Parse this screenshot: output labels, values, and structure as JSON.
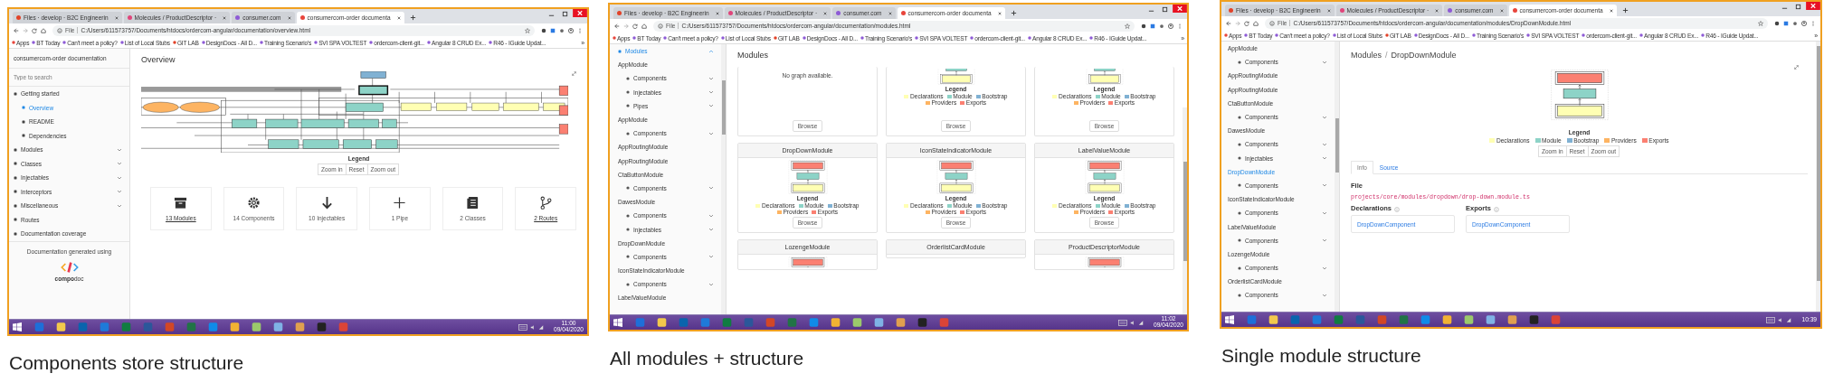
{
  "screens": [
    {
      "kind": "overview",
      "browser": {
        "tabs": [
          {
            "title": "Files · develop · B2C Engineerin",
            "selected": false
          },
          {
            "title": "Molecules / ProductDescriptor ·",
            "selected": false
          },
          {
            "title": "consumer.com",
            "selected": false
          },
          {
            "title": "consumercom-order documenta",
            "selected": true
          }
        ],
        "scheme": "File",
        "url": "C:/Users/611573757/Documents/htdocs/ordercom-angular/documentation/overview.html",
        "bookmarks": [
          "Apps",
          "BT Today",
          "Can't meet a policy?",
          "List of Local Stubs",
          "GIT LAB",
          "DesignDocs - All D...",
          "Training Scenario's",
          "SVI SPA VOLTEST",
          "ordercom-client-git...",
          "Angular 8 CRUD Ex...",
          "R46 - IGuide Updat..."
        ],
        "bookmarks_more": "»"
      },
      "sidebar": {
        "title": "consumercom-order documentation",
        "search": {
          "placeholder": "Type to search"
        },
        "items": [
          {
            "label": "Getting started",
            "kind": "group",
            "selected": false
          },
          {
            "label": "Overview",
            "kind": "link",
            "selected": true
          },
          {
            "label": "README",
            "kind": "link",
            "selected": false
          },
          {
            "label": "Dependencies",
            "kind": "link",
            "selected": false
          },
          {
            "label": "Modules",
            "kind": "section",
            "expanded": false,
            "selected": false
          },
          {
            "label": "Classes",
            "kind": "section",
            "expanded": false,
            "selected": false
          },
          {
            "label": "Injectables",
            "kind": "section",
            "expanded": false,
            "selected": false
          },
          {
            "label": "Interceptors",
            "kind": "section",
            "expanded": false,
            "selected": false
          },
          {
            "label": "Miscellaneous",
            "kind": "section",
            "expanded": false,
            "selected": false
          },
          {
            "label": "Routes",
            "kind": "group",
            "selected": false
          },
          {
            "label": "Documentation coverage",
            "kind": "group",
            "selected": false
          }
        ],
        "footer": {
          "text": "Documentation generated using",
          "logo_strong": "compo",
          "logo_light": "doc"
        }
      },
      "main": {
        "title": "Overview",
        "legend_title": "Legend",
        "zoom_buttons": [
          "Zoom in",
          "Reset",
          "Zoom out"
        ],
        "stats": [
          {
            "label": "13 Modules",
            "kind": "modules",
            "link": true
          },
          {
            "label": "14 Components",
            "kind": "components",
            "link": false
          },
          {
            "label": "10 Injectables",
            "kind": "injectables",
            "link": false
          },
          {
            "label": "1 Pipe",
            "kind": "pipes",
            "link": false
          },
          {
            "label": "2 Classes",
            "kind": "classes",
            "link": false
          },
          {
            "label": "2 Routes",
            "kind": "routes",
            "link": true
          }
        ]
      },
      "taskbar": {
        "time": "11:00",
        "date": "09/04/2020"
      },
      "caption": "Components store structure"
    },
    {
      "kind": "modules",
      "browser": {
        "tabs": [
          {
            "title": "Files · develop · B2C Engineerin",
            "selected": false
          },
          {
            "title": "Molecules / ProductDescriptor ·",
            "selected": false
          },
          {
            "title": "consumer.com",
            "selected": false
          },
          {
            "title": "consumercom-order documenta",
            "selected": true
          }
        ],
        "scheme": "File",
        "url": "C:/Users/611573757/Documents/htdocs/ordercom-angular/documentation/modules.html",
        "bookmarks": [
          "Apps",
          "BT Today",
          "Can't meet a policy?",
          "List of Local Stubs",
          "GIT LAB",
          "DesignDocs - All D...",
          "Training Scenario's",
          "SVI SPA VOLTEST",
          "ordercom-client-git...",
          "Angular 8 CRUD Ex...",
          "R46 - IGuide Updat..."
        ],
        "bookmarks_more": "»"
      },
      "sidebar": {
        "items": [
          {
            "label": "Modules",
            "kind": "section",
            "expanded": true,
            "selected": true
          },
          {
            "label": "AppModule",
            "kind": "module",
            "selected": false
          },
          {
            "label": "Components",
            "kind": "sub",
            "expanded": false,
            "selected": false
          },
          {
            "label": "Injectables",
            "kind": "sub",
            "expanded": false,
            "selected": false
          },
          {
            "label": "Pipes",
            "kind": "sub",
            "expanded": false,
            "selected": false
          },
          {
            "label": "AppModule",
            "kind": "module",
            "selected": false
          },
          {
            "label": "Components",
            "kind": "sub",
            "expanded": false,
            "selected": false
          },
          {
            "label": "AppRoutingModule",
            "kind": "module",
            "selected": false
          },
          {
            "label": "AppRoutingModule",
            "kind": "module",
            "selected": false
          },
          {
            "label": "CtaButtonModule",
            "kind": "module",
            "selected": false
          },
          {
            "label": "Components",
            "kind": "sub",
            "expanded": false,
            "selected": false
          },
          {
            "label": "DawesModule",
            "kind": "module",
            "selected": false
          },
          {
            "label": "Components",
            "kind": "sub",
            "expanded": false,
            "selected": false
          },
          {
            "label": "Injectables",
            "kind": "sub",
            "expanded": false,
            "selected": false
          },
          {
            "label": "DropDownModule",
            "kind": "module",
            "selected": false
          },
          {
            "label": "Components",
            "kind": "sub",
            "expanded": false,
            "selected": false
          },
          {
            "label": "IconStateIndicatorModule",
            "kind": "module",
            "selected": false
          },
          {
            "label": "Components",
            "kind": "sub",
            "expanded": false,
            "selected": false
          },
          {
            "label": "LabelValueModule",
            "kind": "module",
            "selected": false
          }
        ]
      },
      "main": {
        "title": "Modules",
        "cards": [
          {
            "note": "No graph available.",
            "graph": false,
            "browse": "Browse"
          },
          {
            "graph": true,
            "legend_title": "Legend",
            "legend": [
              {
                "label": "Declarations",
                "color": "#ffffb3"
              },
              {
                "label": "Module",
                "color": "#8dd3c7"
              },
              {
                "label": "Bootstrap",
                "color": "#80b1d3"
              },
              {
                "label": "Providers",
                "color": "#fdb462"
              },
              {
                "label": "Exports",
                "color": "#fb8072"
              }
            ],
            "browse": "Browse"
          },
          {
            "graph": true,
            "legend_title": "Legend",
            "legend": [
              {
                "label": "Declarations",
                "color": "#ffffb3"
              },
              {
                "label": "Module",
                "color": "#8dd3c7"
              },
              {
                "label": "Bootstrap",
                "color": "#80b1d3"
              },
              {
                "label": "Providers",
                "color": "#fdb462"
              },
              {
                "label": "Exports",
                "color": "#fb8072"
              }
            ],
            "browse": "Browse"
          },
          {
            "title": "DropDownModule",
            "graph": true,
            "legend_title": "Legend",
            "legend": [
              {
                "label": "Declarations",
                "color": "#ffffb3"
              },
              {
                "label": "Module",
                "color": "#8dd3c7"
              },
              {
                "label": "Bootstrap",
                "color": "#80b1d3"
              },
              {
                "label": "Providers",
                "color": "#fdb462"
              },
              {
                "label": "Exports",
                "color": "#fb8072"
              }
            ],
            "browse": "Browse"
          },
          {
            "title": "IconStateIndicatorModule",
            "graph": true,
            "legend_title": "Legend",
            "legend": [
              {
                "label": "Declarations",
                "color": "#ffffb3"
              },
              {
                "label": "Module",
                "color": "#8dd3c7"
              },
              {
                "label": "Bootstrap",
                "color": "#80b1d3"
              },
              {
                "label": "Providers",
                "color": "#fdb462"
              },
              {
                "label": "Exports",
                "color": "#fb8072"
              }
            ],
            "browse": "Browse"
          },
          {
            "title": "LabelValueModule",
            "graph": true,
            "legend_title": "Legend",
            "legend": [
              {
                "label": "Declarations",
                "color": "#ffffb3"
              },
              {
                "label": "Module",
                "color": "#8dd3c7"
              },
              {
                "label": "Bootstrap",
                "color": "#80b1d3"
              },
              {
                "label": "Providers",
                "color": "#fdb462"
              },
              {
                "label": "Exports",
                "color": "#fb8072"
              }
            ],
            "browse": "Browse"
          },
          {
            "title": "LozengeModule",
            "graph": true
          },
          {
            "title": "OrderlistCardModule",
            "graph": false
          },
          {
            "title": "ProductDescriptorModule",
            "graph": true
          }
        ]
      },
      "taskbar": {
        "time": "11:02",
        "date": "09/04/2020"
      },
      "caption": "All modules + structure"
    },
    {
      "kind": "module",
      "browser": {
        "tabs": [
          {
            "title": "Files · develop · B2C Engineerin",
            "selected": false
          },
          {
            "title": "Molecules / ProductDescriptor ·",
            "selected": false
          },
          {
            "title": "consumer.com",
            "selected": false
          },
          {
            "title": "consumercom-order documenta",
            "selected": true
          }
        ],
        "scheme": "File",
        "url": "C:/Users/611573757/Documents/htdocs/ordercom-angular/documentation/modules/DropDownModule.html",
        "bookmarks": [
          "Apps",
          "BT Today",
          "Can't meet a policy?",
          "List of Local Stubs",
          "GIT LAB",
          "DesignDocs - All D...",
          "Training Scenario's",
          "SVI SPA VOLTEST",
          "ordercom-client-git...",
          "Angular 8 CRUD Ex...",
          "R46 - IGuide Updat..."
        ],
        "bookmarks_more": "»"
      },
      "sidebar": {
        "items": [
          {
            "label": "AppModule",
            "kind": "module",
            "selected": false
          },
          {
            "label": "Components",
            "kind": "sub",
            "expanded": false,
            "selected": false
          },
          {
            "label": "AppRoutingModule",
            "kind": "module",
            "selected": false
          },
          {
            "label": "AppRoutingModule",
            "kind": "module",
            "selected": false
          },
          {
            "label": "CtaButtonModule",
            "kind": "module",
            "selected": false
          },
          {
            "label": "Components",
            "kind": "sub",
            "expanded": false,
            "selected": false
          },
          {
            "label": "DawesModule",
            "kind": "module",
            "selected": false
          },
          {
            "label": "Components",
            "kind": "sub",
            "expanded": false,
            "selected": false
          },
          {
            "label": "Injectables",
            "kind": "sub",
            "expanded": false,
            "selected": false
          },
          {
            "label": "DropDownModule",
            "kind": "module",
            "selected": true
          },
          {
            "label": "Components",
            "kind": "sub",
            "expanded": false,
            "selected": false
          },
          {
            "label": "IconStateIndicatorModule",
            "kind": "module",
            "selected": false
          },
          {
            "label": "Components",
            "kind": "sub",
            "expanded": false,
            "selected": false
          },
          {
            "label": "LabelValueModule",
            "kind": "module",
            "selected": false
          },
          {
            "label": "Components",
            "kind": "sub",
            "expanded": false,
            "selected": false
          },
          {
            "label": "LozengeModule",
            "kind": "module",
            "selected": false
          },
          {
            "label": "Components",
            "kind": "sub",
            "expanded": false,
            "selected": false
          },
          {
            "label": "OrderlistCardModule",
            "kind": "module",
            "selected": false
          },
          {
            "label": "Components",
            "kind": "sub",
            "expanded": false,
            "selected": false
          }
        ]
      },
      "main": {
        "breadcrumb": [
          "Modules",
          "DropDownModule"
        ],
        "breadcrumb_separator": "/",
        "legend_title": "Legend",
        "legend": [
          {
            "label": "Declarations",
            "color": "#ffffb3"
          },
          {
            "label": "Module",
            "color": "#8dd3c7"
          },
          {
            "label": "Bootstrap",
            "color": "#80b1d3"
          },
          {
            "label": "Providers",
            "color": "#fdb462"
          },
          {
            "label": "Exports",
            "color": "#fb8072"
          }
        ],
        "zoom_buttons": [
          "Zoom in",
          "Reset",
          "Zoom out"
        ],
        "tabs": [
          {
            "label": "Info",
            "selected": true
          },
          {
            "label": "Source",
            "selected": false
          }
        ],
        "file_heading": "File",
        "file_path": "projects/core/modules/dropdown/drop-down.module.ts",
        "lists": [
          {
            "heading": "Declarations",
            "items": [
              "DropDownComponent"
            ]
          },
          {
            "heading": "Exports",
            "items": [
              "DropDownComponent"
            ]
          }
        ]
      },
      "taskbar": {
        "time": "10:39"
      },
      "caption": "Single module structure"
    }
  ]
}
